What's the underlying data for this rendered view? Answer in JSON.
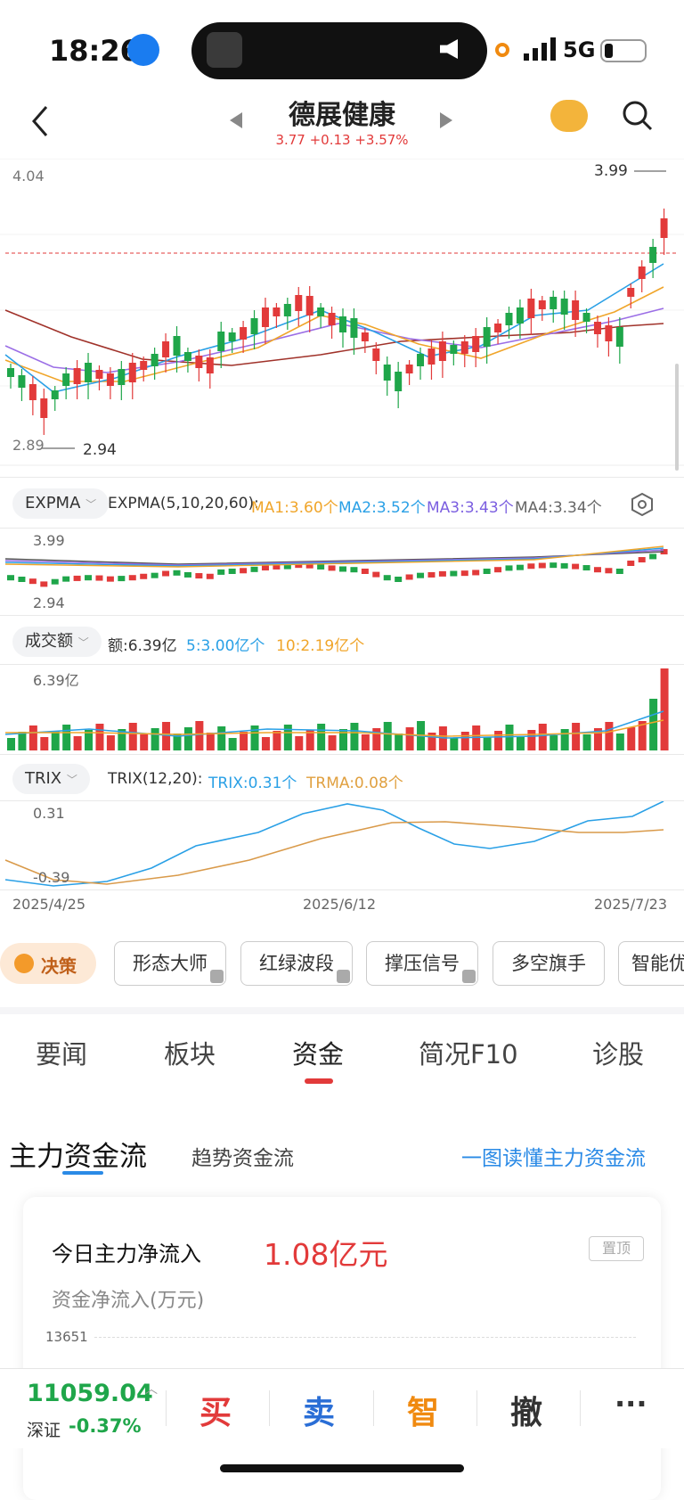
{
  "status_bar": {
    "time": "18:26",
    "network": "5G"
  },
  "header": {
    "back_icon": "chevron-left-icon",
    "stock_name": "德展健康",
    "quote": "3.77 +0.13 +3.57%",
    "mascot_icon": "mascot-icon",
    "search_icon": "search-icon"
  },
  "kline": {
    "price_high_label": "4.04",
    "price_low_label": "2.89",
    "max_marker": "3.99",
    "min_marker": "2.94"
  },
  "expma": {
    "selector_label": "EXPMA",
    "title": "EXPMA(5,10,20,60):",
    "ma1": "MA1:3.60个",
    "ma2": "MA2:3.52个",
    "ma3": "MA3:3.43个",
    "ma4": "MA4:3.34个",
    "top_label": "3.99",
    "bottom_label": "2.94"
  },
  "volume": {
    "selector_label": "成交额",
    "amount": "额:6.39亿",
    "ma5": "5:3.00亿个",
    "ma10": "10:2.19亿个",
    "top_label": "6.39亿"
  },
  "trix": {
    "selector_label": "TRIX",
    "title": "TRIX(12,20):",
    "trix": "TRIX:0.31个",
    "trma": "TRMA:0.08个",
    "top_label": "0.31",
    "bottom_label": "-0.39"
  },
  "dates": [
    "2025/4/25",
    "2025/6/12",
    "2025/7/23"
  ],
  "toolbar": {
    "decision": "决策",
    "buttons": [
      "形态大师",
      "红绿波段",
      "撑压信号",
      "多空旗手",
      "智能优"
    ]
  },
  "tabs": [
    "要闻",
    "板块",
    "资金",
    "简况F10",
    "诊股"
  ],
  "fund_flow": {
    "tab_main": "主力资金流",
    "tab_trend": "趋势资金流",
    "link": "一图读懂主力资金流",
    "today_label": "今日主力净流入",
    "today_value": "1.08亿元",
    "pin_label": "置顶",
    "chart_label": "资金净流入(万元)",
    "y_top": "13651"
  },
  "bottom_bar": {
    "index_value": "11059.04",
    "index_name": "深证",
    "index_change": "-0.37%",
    "buy": "买",
    "sell": "卖",
    "smart": "智",
    "cancel": "撤",
    "more": "···"
  },
  "colors": {
    "up": "#e23a3a",
    "down": "#1fa64a",
    "ma1": "#f0a52a",
    "ma2": "#2aa0e6",
    "ma3": "#9b6ee6",
    "ma4": "#a0322a"
  },
  "chart_data": {
    "type": "candlestick",
    "y_range": [
      2.89,
      4.04
    ],
    "current_price": 3.77,
    "period": [
      "2025/4/25",
      "2025/7/23"
    ]
  }
}
